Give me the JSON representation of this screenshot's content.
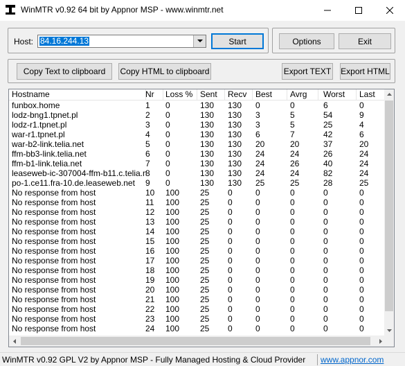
{
  "window": {
    "title": "WinMTR v0.92 64 bit by Appnor MSP - www.winmtr.net"
  },
  "host": {
    "label": "Host:",
    "value": "84.16.244.13"
  },
  "buttons": {
    "start": "Start",
    "options": "Options",
    "exit": "Exit",
    "copy_text": "Copy Text to clipboard",
    "copy_html": "Copy HTML to clipboard",
    "export_text": "Export TEXT",
    "export_html": "Export HTML"
  },
  "table": {
    "columns": [
      "Hostname",
      "Nr",
      "Loss %",
      "Sent",
      "Recv",
      "Best",
      "Avrg",
      "Worst",
      "Last"
    ],
    "rows": [
      [
        "funbox.home",
        "1",
        "0",
        "130",
        "130",
        "0",
        "0",
        "6",
        "0"
      ],
      [
        "lodz-bng1.tpnet.pl",
        "2",
        "0",
        "130",
        "130",
        "3",
        "5",
        "54",
        "9"
      ],
      [
        "lodz-r1.tpnet.pl",
        "3",
        "0",
        "130",
        "130",
        "3",
        "5",
        "25",
        "4"
      ],
      [
        "war-r1.tpnet.pl",
        "4",
        "0",
        "130",
        "130",
        "6",
        "7",
        "42",
        "6"
      ],
      [
        "war-b2-link.telia.net",
        "5",
        "0",
        "130",
        "130",
        "20",
        "20",
        "37",
        "20"
      ],
      [
        "ffm-bb3-link.telia.net",
        "6",
        "0",
        "130",
        "130",
        "24",
        "24",
        "26",
        "24"
      ],
      [
        "ffm-b1-link.telia.net",
        "7",
        "0",
        "130",
        "130",
        "24",
        "26",
        "40",
        "24"
      ],
      [
        "leaseweb-ic-307004-ffm-b11.c.telia.net",
        "8",
        "0",
        "130",
        "130",
        "24",
        "24",
        "82",
        "24"
      ],
      [
        "po-1.ce11.fra-10.de.leaseweb.net",
        "9",
        "0",
        "130",
        "130",
        "25",
        "25",
        "28",
        "25"
      ],
      [
        "No response from host",
        "10",
        "100",
        "25",
        "0",
        "0",
        "0",
        "0",
        "0"
      ],
      [
        "No response from host",
        "11",
        "100",
        "25",
        "0",
        "0",
        "0",
        "0",
        "0"
      ],
      [
        "No response from host",
        "12",
        "100",
        "25",
        "0",
        "0",
        "0",
        "0",
        "0"
      ],
      [
        "No response from host",
        "13",
        "100",
        "25",
        "0",
        "0",
        "0",
        "0",
        "0"
      ],
      [
        "No response from host",
        "14",
        "100",
        "25",
        "0",
        "0",
        "0",
        "0",
        "0"
      ],
      [
        "No response from host",
        "15",
        "100",
        "25",
        "0",
        "0",
        "0",
        "0",
        "0"
      ],
      [
        "No response from host",
        "16",
        "100",
        "25",
        "0",
        "0",
        "0",
        "0",
        "0"
      ],
      [
        "No response from host",
        "17",
        "100",
        "25",
        "0",
        "0",
        "0",
        "0",
        "0"
      ],
      [
        "No response from host",
        "18",
        "100",
        "25",
        "0",
        "0",
        "0",
        "0",
        "0"
      ],
      [
        "No response from host",
        "19",
        "100",
        "25",
        "0",
        "0",
        "0",
        "0",
        "0"
      ],
      [
        "No response from host",
        "20",
        "100",
        "25",
        "0",
        "0",
        "0",
        "0",
        "0"
      ],
      [
        "No response from host",
        "21",
        "100",
        "25",
        "0",
        "0",
        "0",
        "0",
        "0"
      ],
      [
        "No response from host",
        "22",
        "100",
        "25",
        "0",
        "0",
        "0",
        "0",
        "0"
      ],
      [
        "No response from host",
        "23",
        "100",
        "25",
        "0",
        "0",
        "0",
        "0",
        "0"
      ],
      [
        "No response from host",
        "24",
        "100",
        "25",
        "0",
        "0",
        "0",
        "0",
        "0"
      ]
    ]
  },
  "status": {
    "text": "WinMTR v0.92 GPL V2 by Appnor MSP - Fully Managed Hosting & Cloud Provider",
    "link": "www.appnor.com"
  },
  "colors": {
    "selection": "#0078d7",
    "link": "#0066cc",
    "focus_border": "#0078d7"
  },
  "icons": [
    "app-icon",
    "minimize-icon",
    "maximize-icon",
    "close-icon",
    "dropdown-arrow-icon",
    "scroll-up-icon",
    "scroll-down-icon",
    "scroll-left-icon",
    "scroll-right-icon"
  ]
}
